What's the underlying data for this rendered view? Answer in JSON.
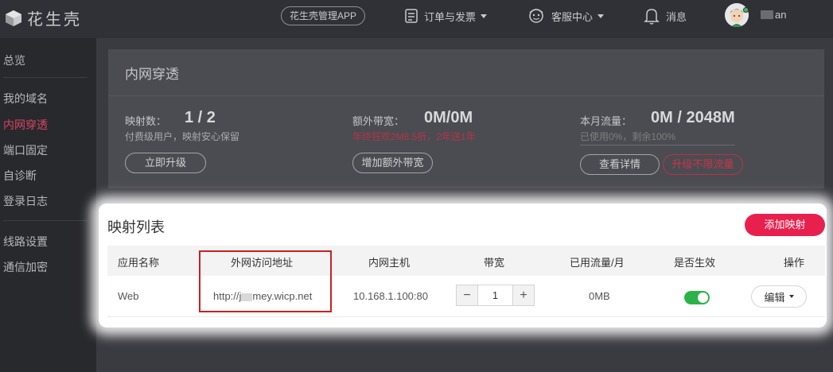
{
  "topbar": {
    "brand": "花生壳",
    "app_button": "花生壳管理APP",
    "orders_label": "订单与发票",
    "service_label": "客服中心",
    "messages_label": "消息",
    "username_suffix": "an"
  },
  "sidebar": {
    "items": [
      {
        "label": "总览"
      },
      {
        "label": "我的域名"
      },
      {
        "label": "内网穿透",
        "active": true
      },
      {
        "label": "端口固定"
      },
      {
        "label": "自诊断"
      },
      {
        "label": "登录日志"
      },
      {
        "label": "线路设置"
      },
      {
        "label": "通信加密"
      }
    ]
  },
  "overview": {
    "title": "内网穿透",
    "mappings": {
      "label": "映射数：",
      "value": "1 / 2",
      "sub": "付费级用户，映射安心保留",
      "button": "立即升级"
    },
    "bandwidth": {
      "label": "额外带宽：",
      "value": "0M/0M",
      "promo": "年终狂欢2M8.5折，2年送1年",
      "button": "增加额外带宽"
    },
    "traffic": {
      "label": "本月流量：",
      "value": "0M / 2048M",
      "sub": "已使用0%，剩余100%",
      "used_fraction": 0,
      "detail_button": "查看详情",
      "upgrade_button": "升级不限流量"
    }
  },
  "mapping_list": {
    "title": "映射列表",
    "add_button": "添加映射",
    "columns": [
      "应用名称",
      "外网访问地址",
      "内网主机",
      "带宽",
      "已用流量/月",
      "是否生效",
      "操作"
    ],
    "rows": [
      {
        "app_name": "Web",
        "url_prefix": "http://j",
        "url_suffix": "mey.wicp.net",
        "host": "10.168.1.100:80",
        "bandwidth": "1",
        "traffic": "0MB",
        "enabled": true,
        "action": "编辑"
      }
    ]
  },
  "colors": {
    "accent_red": "#e8204e",
    "active_side": "#d74562",
    "toggle_on": "#2bb34a",
    "highlight_border": "#cc1f1f"
  }
}
